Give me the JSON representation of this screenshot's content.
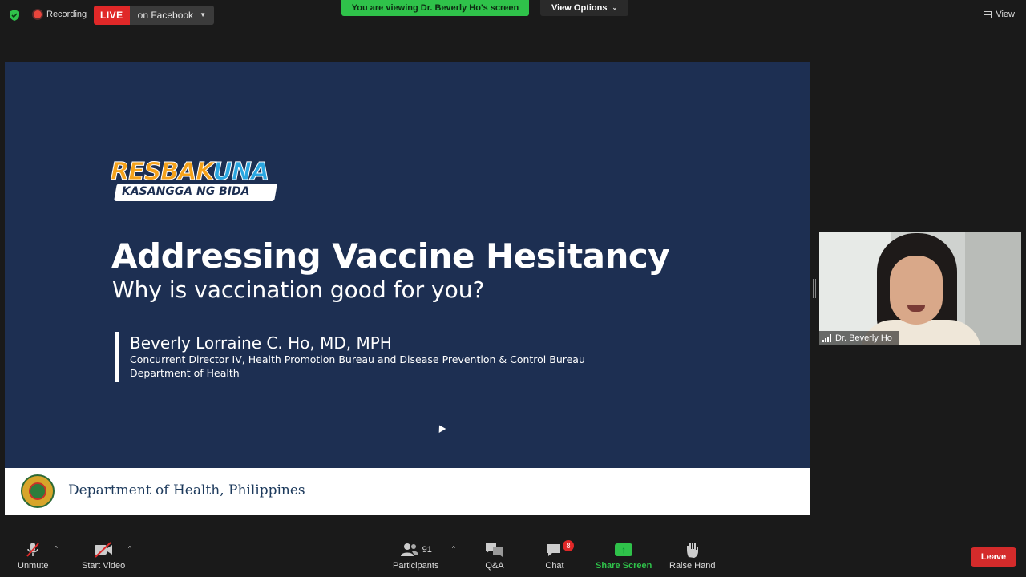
{
  "topbar": {
    "recording_label": "Recording",
    "live_label": "LIVE",
    "live_destination": "on Facebook",
    "viewing_banner": "You are viewing Dr. Beverly Ho's screen",
    "view_options_label": "View Options",
    "view_label": "View"
  },
  "slide": {
    "logo_top_a": "RESBAK",
    "logo_top_b": "UNA",
    "logo_bottom": "KASANGGA NG BIDA",
    "title": "Addressing Vaccine Hesitancy",
    "subtitle": "Why is vaccination good for you?",
    "presenter_name": "Beverly Lorraine C. Ho, MD, MPH",
    "presenter_role": "Concurrent Director IV, Health Promotion Bureau and Disease Prevention & Control Bureau",
    "presenter_dept": "Department of Health",
    "footer_text": "Department of Health, Philippines"
  },
  "participant_video": {
    "name": "Dr. Beverly Ho"
  },
  "toolbar": {
    "unmute_label": "Unmute",
    "start_video_label": "Start Video",
    "participants_label": "Participants",
    "participants_count": "91",
    "qa_label": "Q&A",
    "chat_label": "Chat",
    "chat_badge": "8",
    "share_screen_label": "Share Screen",
    "raise_hand_label": "Raise Hand",
    "leave_label": "Leave"
  },
  "colors": {
    "slide_bg": "#1d2f52",
    "live_red": "#e02828",
    "banner_green": "#2fc24a",
    "leave_red": "#d42b2b"
  }
}
